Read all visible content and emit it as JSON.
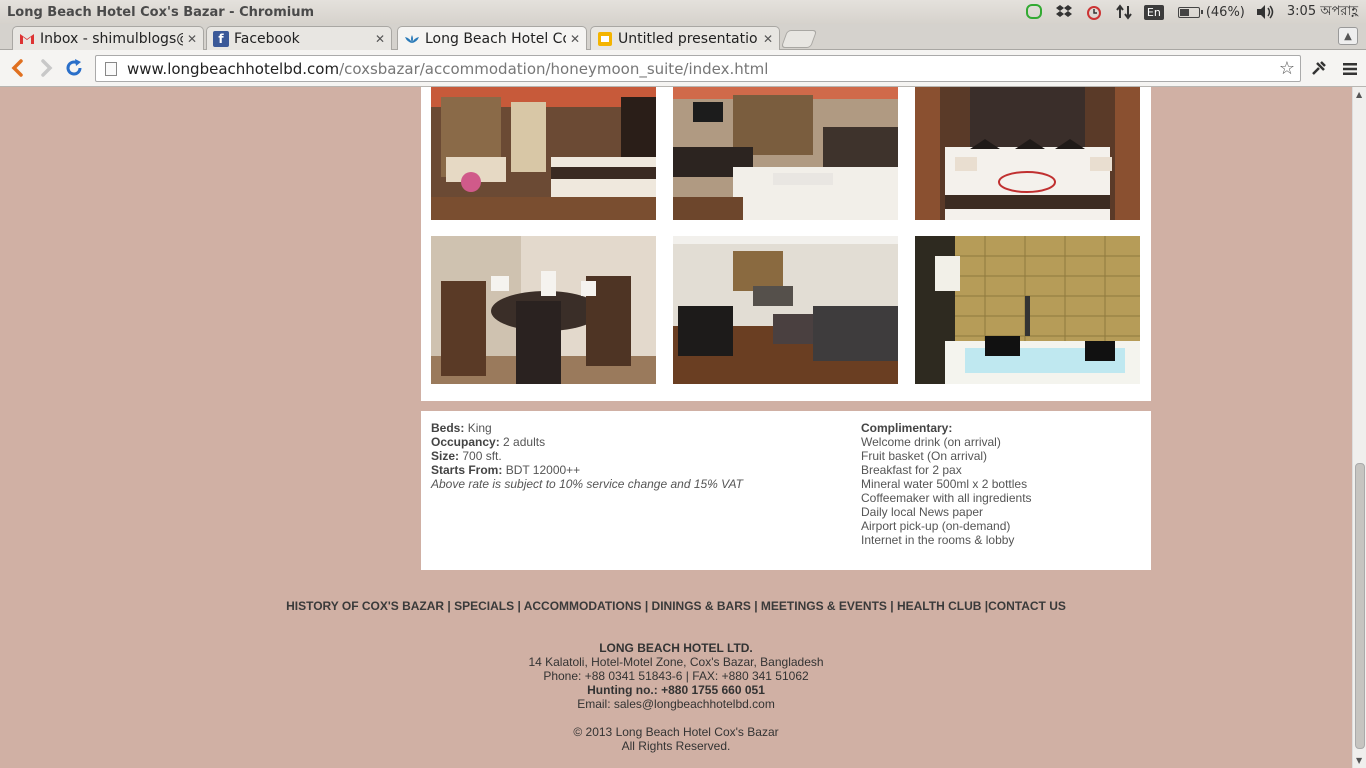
{
  "window": {
    "title": "Long Beach Hotel Cox's Bazar - Chromium"
  },
  "tray": {
    "language": "En",
    "battery": "(46%)",
    "battery_level": 0.46,
    "clock": "3:05 অপরাহ্ণ"
  },
  "tabs": [
    {
      "label": "Inbox - shimulblogs@",
      "icon": "gmail-icon"
    },
    {
      "label": "Facebook",
      "icon": "facebook-icon"
    },
    {
      "label": "Long Beach Hotel Co",
      "icon": "lotus-icon"
    },
    {
      "label": "Untitled presentatio",
      "icon": "slides-icon"
    }
  ],
  "omnibox": {
    "domain": "www.longbeachhotelbd.com",
    "path": "/coxsbazar/accommodation/honeymoon_suite/index.html"
  },
  "details": {
    "beds_label": "Beds:",
    "beds": "King",
    "occupancy_label": "Occupancy:",
    "occupancy": "2 adults",
    "size_label": "Size:",
    "size": "700 sft.",
    "starts_label": "Starts From:",
    "starts": "BDT 12000++",
    "note": "Above rate is subject to 10% service change and 15% VAT",
    "complimentary_label": "Complimentary:",
    "complimentary": [
      "Welcome drink (on arrival)",
      "Fruit basket (On arrival)",
      "Breakfast for 2 pax",
      "Mineral water 500ml x 2 bottles",
      "Coffeemaker with all ingredients",
      "Daily local News paper",
      "Airport pick-up (on-demand)",
      "Internet in the rooms & lobby"
    ]
  },
  "footer_nav": [
    {
      "label": "HISTORY OF COX'S BAZAR",
      "sep": " | "
    },
    {
      "label": "SPECIALS",
      "sep": " | "
    },
    {
      "label": "ACCOMMODATIONS",
      "sep": " | "
    },
    {
      "label": "DININGS & BARS",
      "sep": " | "
    },
    {
      "label": "MEETINGS & EVENTS",
      "sep": " | "
    },
    {
      "label": "HEALTH CLUB",
      "sep": " |"
    },
    {
      "label": "CONTACT US",
      "sep": ""
    }
  ],
  "footer": {
    "company": "LONG BEACH HOTEL LTD.",
    "address": "14 Kalatoli, Hotel-Motel Zone, Cox's Bazar, Bangladesh",
    "phone": "Phone: +88 0341 51843-6 | FAX: +880 341 51062",
    "hunting": "Hunting no.: +880 1755 660 051",
    "email": "Email: sales@longbeachhotelbd.com",
    "copyright": "© 2013 Long Beach Hotel Cox's Bazar",
    "rights": "All Rights Reserved."
  }
}
